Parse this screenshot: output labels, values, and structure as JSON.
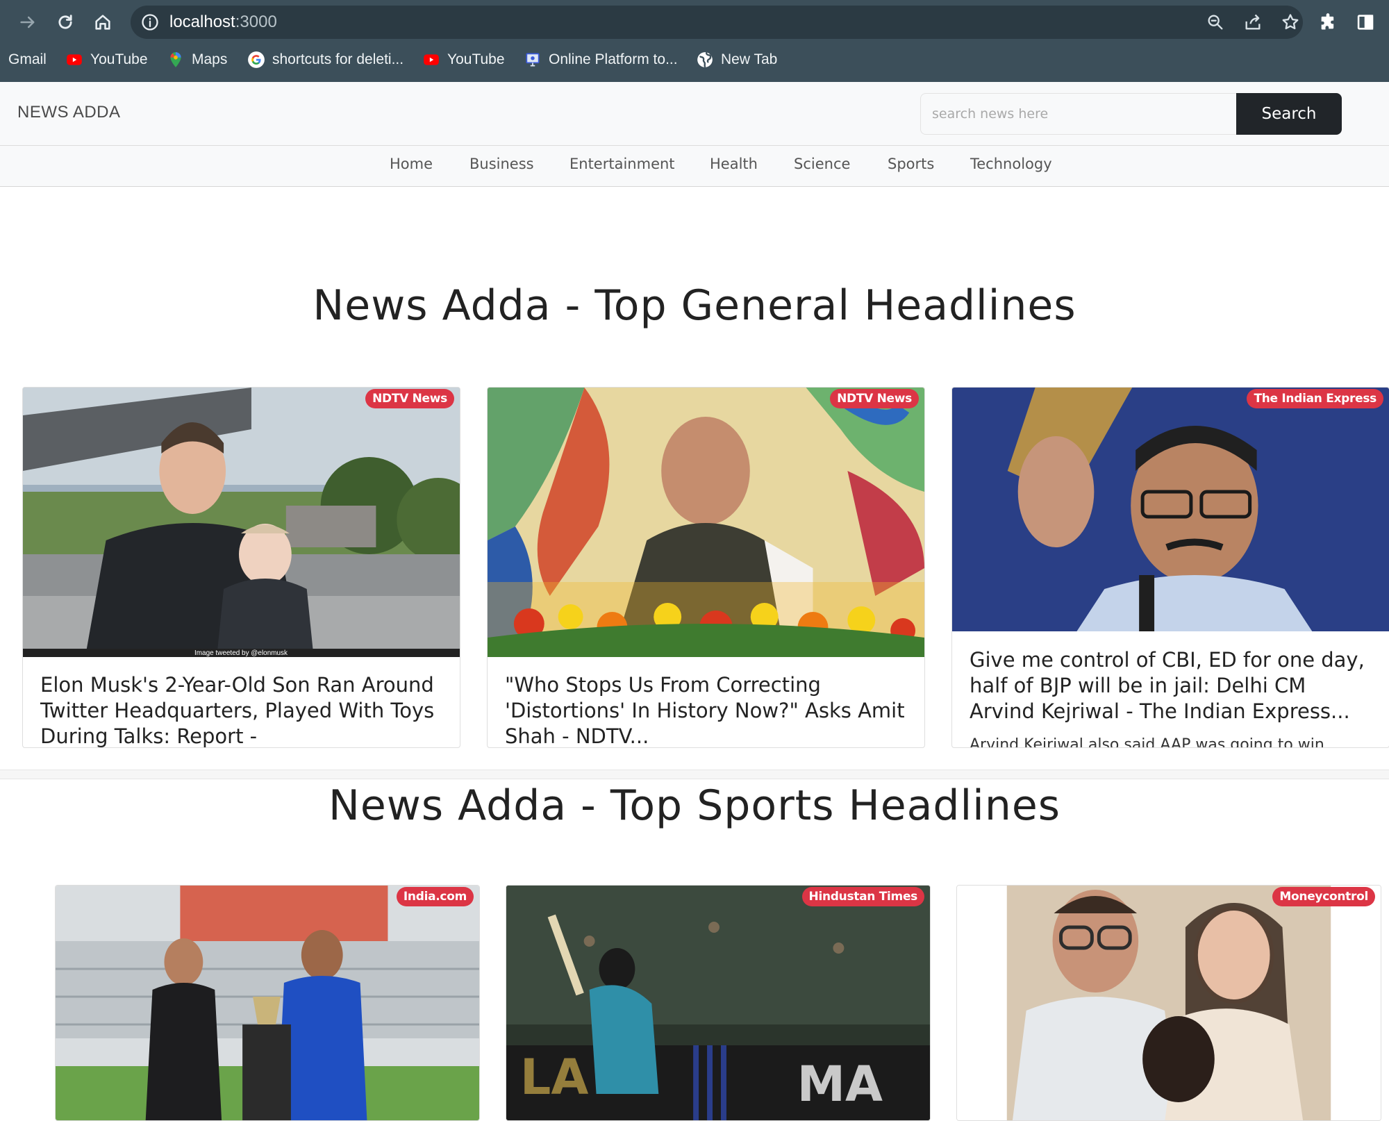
{
  "browser": {
    "url_host": "localhost",
    "url_port": ":3000",
    "bookmarks": [
      {
        "label": "Gmail",
        "icon": "none"
      },
      {
        "label": "YouTube",
        "icon": "youtube-icon"
      },
      {
        "label": "Maps",
        "icon": "maps-icon"
      },
      {
        "label": "shortcuts for deleti...",
        "icon": "google-icon"
      },
      {
        "label": "YouTube",
        "icon": "youtube-icon"
      },
      {
        "label": "Online Platform to...",
        "icon": "platform-icon"
      },
      {
        "label": "New Tab",
        "icon": "globe-icon"
      }
    ]
  },
  "header": {
    "brand": "NEWS ADDA",
    "search_placeholder": "search news here",
    "search_button": "Search"
  },
  "nav": {
    "items": [
      "Home",
      "Business",
      "Entertainment",
      "Health",
      "Science",
      "Sports",
      "Technology"
    ]
  },
  "sections": [
    {
      "title": "News Adda - Top General Headlines",
      "cards": [
        {
          "source": "NDTV News",
          "title": "Elon Musk's 2-Year-Old Son Ran Around Twitter Headquarters, Played With Toys During Talks: Report -",
          "image_credit": "Image tweeted by @elonmusk"
        },
        {
          "source": "NDTV News",
          "title": "\"Who Stops Us From Correcting 'Distortions' In History Now?\" Asks Amit Shah - NDTV..."
        },
        {
          "source": "The Indian Express",
          "title": "Give me control of CBI, ED for one day, half of BJP will be in jail: Delhi CM Arvind Kejriwal - The Indian Express...",
          "description": "Arvind Kejriwal also said AAP was going to win"
        }
      ]
    },
    {
      "title": "News Adda - Top Sports Headlines",
      "cards": [
        {
          "source": "India.com"
        },
        {
          "source": "Hindustan Times"
        },
        {
          "source": "Moneycontrol"
        }
      ]
    }
  ],
  "colors": {
    "chrome": "#3c4f5a",
    "badge": "#dc3545",
    "search_button": "#212529"
  }
}
